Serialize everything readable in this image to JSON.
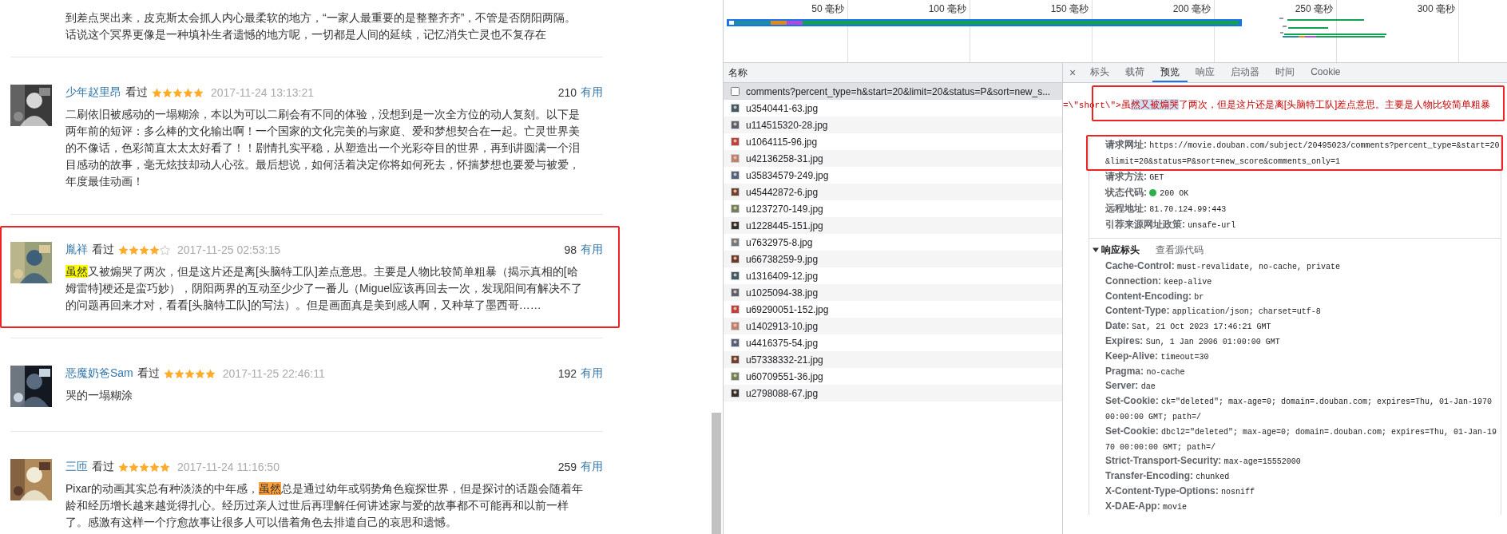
{
  "comments": {
    "fragment": "到差点哭出来，皮克斯太会抓人内心最柔软的地方，“一家人最重要的是整整齐齐”，不管是否阴阳两隔。话说这个冥界更像是一种填补生者遗憾的地方呢，一切都是人间的延续，记忆消失亡灵也不复存在",
    "reviews": [
      {
        "user": "少年赵里昂",
        "status": "看过",
        "stars": 5,
        "time": "2017-11-24 13:13:21",
        "votes": "210",
        "vote_label": "有用",
        "annotated": false,
        "text": [
          {
            "text": "二刷依旧被感动的一塌糊涂，本以为可以二刷会有不同的体验，没想到是一次全方位的动人复刻。以下是两年前的短评：多么棒的文化输出啊！一个国家的文化完美的与家庭、爱和梦想契合在一起。亡灵世界美的不像话，色彩简直太太太好看了！！剧情扎实平稳，从塑造出一个光彩夺目的世界，再到讲圆满一个泪目感动的故事，毫无炫技却动人心弦。最后想说，如何活着决定你将如何死去，怀揣梦想也要爱与被爱，年度最佳动画！"
          }
        ]
      },
      {
        "user": "胤祥",
        "status": "看过",
        "stars": 4,
        "time": "2017-11-25 02:53:15",
        "votes": "98",
        "vote_label": "有用",
        "annotated": true,
        "text": [
          {
            "text": "虽然",
            "color": "#ffff00"
          },
          {
            "text": "又被煽哭了两次，但是这片还是离[头脑特工队]差点意思。主要是人物比较简单粗暴（揭示真相的[哈姆雷特]梗还是蛮巧妙），阴阳两界的互动至少少了一番儿（Miguel应该再回去一次，发现阳间有解决不了的问题再回来才对，看看[头脑特工队]的写法）。但是画面真是美到感人啊，又种草了墨西哥……"
          }
        ]
      },
      {
        "user": "恶魔奶爸Sam",
        "status": "看过",
        "stars": 5,
        "time": "2017-11-25 22:46:11",
        "votes": "192",
        "vote_label": "有用",
        "annotated": false,
        "text": [
          {
            "text": "哭的一塌糊涂"
          }
        ]
      },
      {
        "user": "三匝",
        "status": "看过",
        "stars": 5,
        "time": "2017-11-24 11:16:50",
        "votes": "259",
        "vote_label": "有用",
        "annotated": false,
        "text": [
          {
            "text": "Pixar的动画其实总有种淡淡的中年感，"
          },
          {
            "text": "虽然",
            "color": "#ffa23a"
          },
          {
            "text": "总是通过幼年或弱势角色窥探世界，但是探讨的话题会随着年龄和经历增长越来越觉得扎心。经历过亲人过世后再理解任何讲述家与爱的故事都不可能再和以前一样了。感激有这样一个疗愈故事让很多人可以借着角色去排遣自己的哀思和遗憾。"
          }
        ]
      }
    ]
  },
  "devtools": {
    "timeline": {
      "ticks": [
        "50 毫秒",
        "100 毫秒",
        "150 毫秒",
        "200 毫秒",
        "250 毫秒",
        "300 毫秒"
      ]
    },
    "network": {
      "column": "名称",
      "requests": [
        {
          "name": "comments?percent_type=h&start=20&limit=20&status=P&sort=new_s...",
          "kind": "document",
          "selected": true
        },
        {
          "name": "u3540441-63.jpg",
          "selected": false
        },
        {
          "name": "u114515320-28.jpg",
          "selected": false
        },
        {
          "name": "u1064115-96.jpg",
          "selected": false
        },
        {
          "name": "u42136258-31.jpg",
          "selected": false
        },
        {
          "name": "u35834579-249.jpg",
          "selected": false
        },
        {
          "name": "u45442872-6.jpg",
          "selected": false
        },
        {
          "name": "u1237270-149.jpg",
          "selected": false
        },
        {
          "name": "u1228445-151.jpg",
          "selected": false
        },
        {
          "name": "u7632975-8.jpg",
          "selected": false
        },
        {
          "name": "u66738259-9.jpg",
          "selected": false
        },
        {
          "name": "u1316409-12.jpg",
          "selected": false
        },
        {
          "name": "u1025094-38.jpg",
          "selected": false
        },
        {
          "name": "u69290051-152.jpg",
          "selected": false
        },
        {
          "name": "u1402913-10.jpg",
          "selected": false
        },
        {
          "name": "u4416375-54.jpg",
          "selected": false
        },
        {
          "name": "u57338332-21.jpg",
          "selected": false
        },
        {
          "name": "u60709551-36.jpg",
          "selected": false
        },
        {
          "name": "u2798088-67.jpg",
          "selected": false
        }
      ]
    },
    "detail": {
      "close": "×",
      "tabs": [
        {
          "label": "标头",
          "selected": false
        },
        {
          "label": "载荷",
          "selected": false
        },
        {
          "label": "预览",
          "selected": true
        },
        {
          "label": "响应",
          "selected": false
        },
        {
          "label": "启动器",
          "selected": false
        },
        {
          "label": "时间",
          "selected": false
        },
        {
          "label": "Cookie",
          "selected": false
        }
      ],
      "preview": {
        "annotated": true,
        "segments": [
          {
            "text": "=\\\"short\\\">",
            "kind": "code",
            "selected": false
          },
          {
            "text": "虽",
            "kind": "text",
            "selected": false
          },
          {
            "text": "然又被煽哭",
            "kind": "text",
            "selected": true
          },
          {
            "text": "了两次，但是这片还是离[头脑特工队]差点意思。主要是人物比较简单粗暴",
            "kind": "text",
            "selected": false
          }
        ]
      },
      "general": [
        {
          "label": "请求网址:",
          "value": "https://movie.douban.com/subject/20495023/comments?percent_type=&start=20&limit=20&status=P&sort=new_score&comments_only=1",
          "annotated": true
        },
        {
          "label": "请求方法:",
          "value": "GET",
          "annotated": false
        },
        {
          "label": "状态代码:",
          "value": "200 OK",
          "color": "#2db04a",
          "annotated": false
        },
        {
          "label": "远程地址:",
          "value": "81.70.124.99:443",
          "annotated": false
        },
        {
          "label": "引荐来源网址政策:",
          "value": "unsafe-url",
          "annotated": false
        }
      ],
      "response_headers": {
        "title": "响应标头",
        "expanded": true,
        "source_link": "查看源代码",
        "items": [
          {
            "name": "Cache-Control:",
            "value": "must-revalidate, no-cache, private"
          },
          {
            "name": "Connection:",
            "value": "keep-alive"
          },
          {
            "name": "Content-Encoding:",
            "value": "br"
          },
          {
            "name": "Content-Type:",
            "value": "application/json; charset=utf-8"
          },
          {
            "name": "Date:",
            "value": "Sat, 21 Oct 2023 17:46:21 GMT"
          },
          {
            "name": "Expires:",
            "value": "Sun, 1 Jan 2006 01:00:00 GMT"
          },
          {
            "name": "Keep-Alive:",
            "value": "timeout=30"
          },
          {
            "name": "Pragma:",
            "value": "no-cache"
          },
          {
            "name": "Server:",
            "value": "dae"
          },
          {
            "name": "Set-Cookie:",
            "value": "ck=\"deleted\"; max-age=0; domain=.douban.com; expires=Thu, 01-Jan-1970 00:00:00 GMT; path=/"
          },
          {
            "name": "Set-Cookie:",
            "value": "dbcl2=\"deleted\"; max-age=0; domain=.douban.com; expires=Thu, 01-Jan-1970 00:00:00 GMT; path=/"
          },
          {
            "name": "Strict-Transport-Security:",
            "value": "max-age=15552000"
          },
          {
            "name": "Transfer-Encoding:",
            "value": "chunked"
          },
          {
            "name": "X-Content-Type-Options:",
            "value": "nosniff"
          },
          {
            "name": "X-DAE-App:",
            "value": "movie"
          }
        ]
      }
    }
  }
}
